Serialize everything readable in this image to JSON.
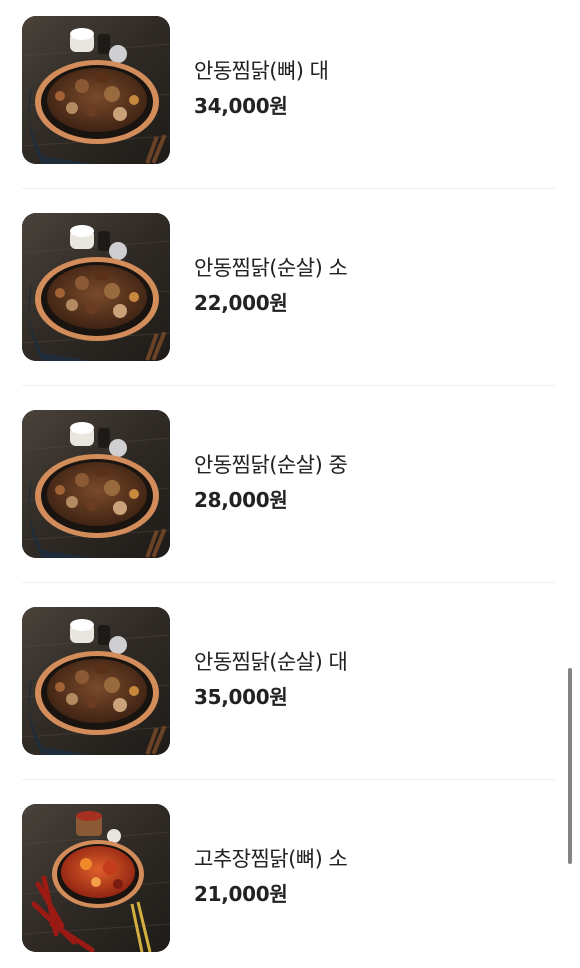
{
  "menu": {
    "items": [
      {
        "name": "안동찜닭(뼈) 대",
        "price": "34,000",
        "currency": "원",
        "image": "jjimdak-photo"
      },
      {
        "name": "안동찜닭(순살) 소",
        "price": "22,000",
        "currency": "원",
        "image": "jjimdak-photo"
      },
      {
        "name": "안동찜닭(순살) 중",
        "price": "28,000",
        "currency": "원",
        "image": "jjimdak-photo"
      },
      {
        "name": "안동찜닭(순살) 대",
        "price": "35,000",
        "currency": "원",
        "image": "jjimdak-photo"
      },
      {
        "name": "고추장찜닭(뼈) 소",
        "price": "21,000",
        "currency": "원",
        "image": "gochujang-jjimdak-photo"
      }
    ]
  },
  "colors": {
    "text": "#222222",
    "divider": "#eef0f3",
    "scrollbar": "#6e6e6e"
  }
}
